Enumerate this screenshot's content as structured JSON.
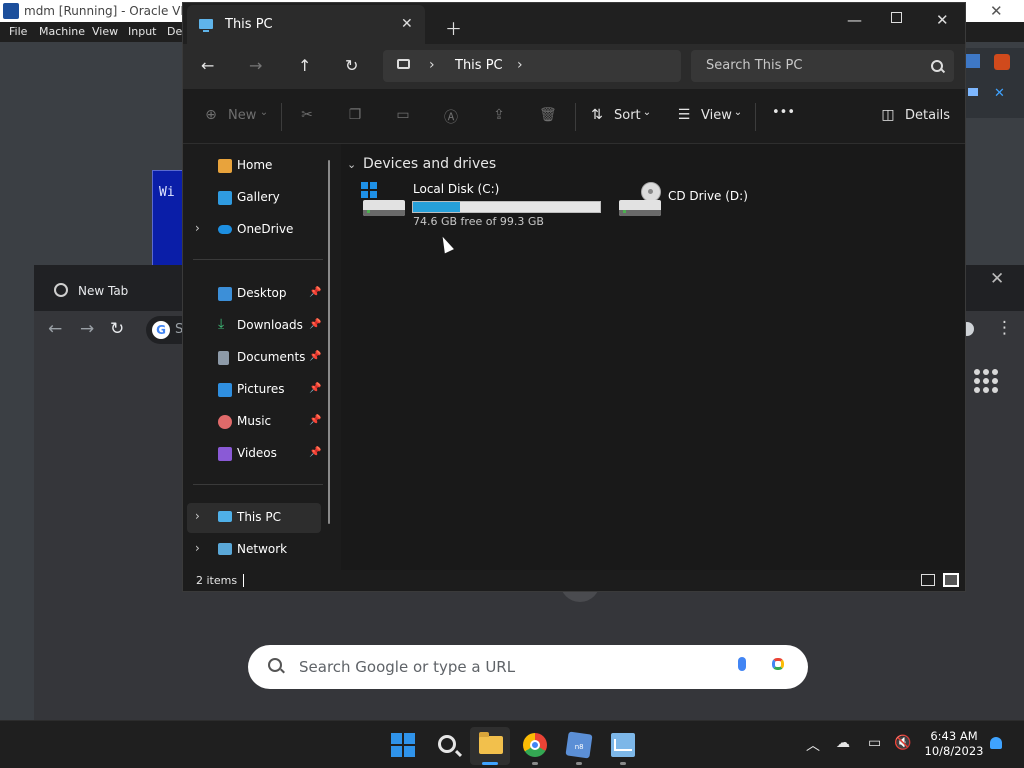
{
  "host": {
    "title": "mdm [Running] - Oracle VM V",
    "menu": [
      "File",
      "Machine",
      "View",
      "Input",
      "De"
    ],
    "blue_window_text": "Wi"
  },
  "chrome": {
    "tab_title": "New Tab",
    "search_placeholder": "Search Google or type a URL",
    "omnibox_letter": "G",
    "address_partial": "S"
  },
  "explorer": {
    "tab_title": "This PC",
    "breadcrumb": "This PC",
    "search_placeholder": "Search This PC",
    "commands": {
      "new": "New",
      "sort": "Sort",
      "view": "View",
      "more": "•••",
      "details": "Details"
    },
    "nav": [
      {
        "label": "Home",
        "icon": "home-icon",
        "pinned": false,
        "expand": false
      },
      {
        "label": "Gallery",
        "icon": "gallery-icon",
        "pinned": false,
        "expand": false
      },
      {
        "label": "OneDrive",
        "icon": "onedrive-icon",
        "pinned": false,
        "expand": true
      },
      {
        "label": "Desktop",
        "icon": "desktop-icon",
        "pinned": true,
        "expand": false
      },
      {
        "label": "Downloads",
        "icon": "downloads-icon",
        "pinned": true,
        "expand": false
      },
      {
        "label": "Documents",
        "icon": "documents-icon",
        "pinned": true,
        "expand": false
      },
      {
        "label": "Pictures",
        "icon": "pictures-icon",
        "pinned": true,
        "expand": false
      },
      {
        "label": "Music",
        "icon": "music-icon",
        "pinned": true,
        "expand": false
      },
      {
        "label": "Videos",
        "icon": "videos-icon",
        "pinned": true,
        "expand": false
      },
      {
        "label": "This PC",
        "icon": "this-pc-icon",
        "pinned": false,
        "expand": true,
        "selected": true
      },
      {
        "label": "Network",
        "icon": "network-icon",
        "pinned": false,
        "expand": true
      }
    ],
    "group_title": "Devices and drives",
    "drives": [
      {
        "name": "Local Disk (C:)",
        "free_text": "74.6 GB free of 99.3 GB",
        "used_fraction": 0.249
      },
      {
        "name": "CD Drive (D:)"
      }
    ],
    "status_items": "2 items"
  },
  "taskbar": {
    "time": "6:43 AM",
    "date": "10/8/2023",
    "vbox_badge": "n8"
  },
  "colors": {
    "accent": "#26a0da",
    "explorer_bg": "#1c1c1c",
    "chrome_bg": "#35363a"
  }
}
